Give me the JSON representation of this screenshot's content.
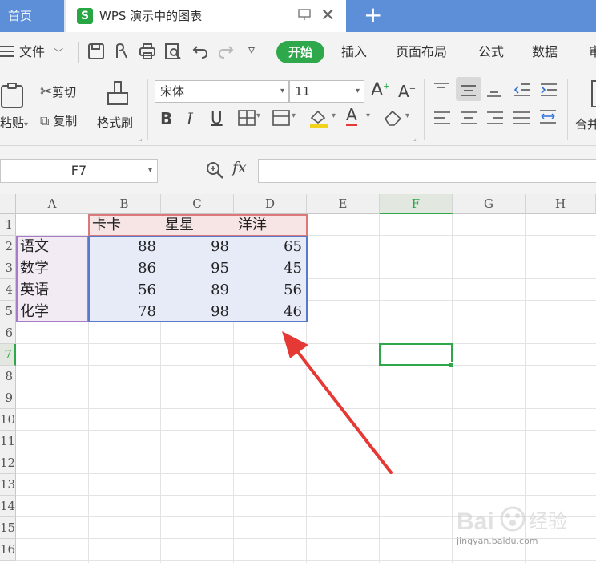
{
  "tabs": {
    "home": "首页",
    "document": {
      "logo": "S",
      "title": "WPS 演示中的图表"
    },
    "new_tab": "+"
  },
  "menu": {
    "file": "文件",
    "start": "开始",
    "items": [
      "插入",
      "页面布局",
      "公式",
      "数据",
      "审"
    ]
  },
  "ribbon": {
    "paste": "粘贴",
    "cut": "剪切",
    "copy": "复制",
    "format_painter": "格式刷",
    "font_name": "宋体",
    "font_size": "11",
    "merge": "合并"
  },
  "formula_bar": {
    "name_box": "F7",
    "fx": "fx",
    "value": ""
  },
  "sheet": {
    "columns": [
      "A",
      "B",
      "C",
      "D",
      "E",
      "F",
      "G",
      "H"
    ],
    "rows": [
      "1",
      "2",
      "3",
      "4",
      "5",
      "6",
      "7",
      "8",
      "9",
      "10",
      "11",
      "12",
      "13",
      "14",
      "15",
      "16"
    ],
    "selected_cell": "F7",
    "headers": [
      "卡卡",
      "星星",
      "洋洋"
    ],
    "data": [
      {
        "label": "语文",
        "values": [
          "88",
          "98",
          "65"
        ]
      },
      {
        "label": "数学",
        "values": [
          "86",
          "95",
          "45"
        ]
      },
      {
        "label": "英语",
        "values": [
          "56",
          "89",
          "56"
        ]
      },
      {
        "label": "化学",
        "values": [
          "78",
          "98",
          "46"
        ]
      }
    ]
  },
  "colors": {
    "accent_green": "#2ea84a",
    "tab_blue": "#5d8fd9",
    "arrow_red": "#e53935",
    "range_header": "#d97979",
    "range_labels": "#a77cc6",
    "range_values": "#5a79c9"
  },
  "watermark": {
    "brand": "Bai 经验",
    "url": "jingyan.baidu.com"
  }
}
